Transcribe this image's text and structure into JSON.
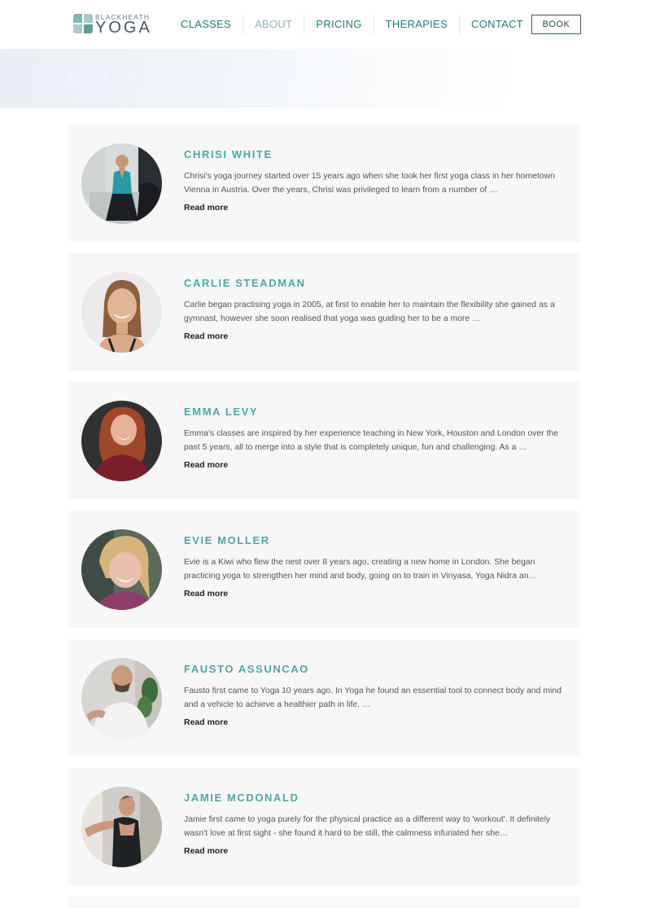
{
  "brand": {
    "top": "BLACKHEATH",
    "bottom": "YOGA"
  },
  "nav": {
    "items": [
      {
        "label": "CLASSES",
        "active": false
      },
      {
        "label": "ABOUT",
        "active": true
      },
      {
        "label": "PRICING",
        "active": false
      },
      {
        "label": "THERAPIES",
        "active": false
      },
      {
        "label": "CONTACT",
        "active": false
      }
    ],
    "book_label": "BOOK"
  },
  "hero": {
    "title": "OUR TEACHERS"
  },
  "teachers": [
    {
      "name": "CHRISI WHITE",
      "bio": "Chrisi's yoga journey started over 15 years ago when she took her first yoga class in her hometown Vienna in Austria. Over the years, Chrisi was privileged to learn from a number of …",
      "read_more": "Read more"
    },
    {
      "name": "CARLIE STEADMAN",
      "bio": "Carlie began practising yoga in 2005, at first to enable her to maintain the flexibility she gained as a gymnast, however she soon realised that yoga was guiding her to be a more …",
      "read_more": "Read more"
    },
    {
      "name": "EMMA LEVY",
      "bio": "Emma's classes are inspired by her experience teaching in New York, Houston and London over the past 5 years, all to merge into a style that is completely unique, fun and challenging. As a …",
      "read_more": "Read more"
    },
    {
      "name": "EVIE MOLLER",
      "bio": "Evie is a Kiwi who flew the nest over 8 years ago, creating a new home in London. She began practicing yoga to strengthen her mind and body, going on to train in Vinyasa, Yoga Nidra an…",
      "read_more": "Read more"
    },
    {
      "name": "FAUSTO ASSUNCAO",
      "bio": "Fausto first came to Yoga 10 years ago. In Yoga he found an essential tool to connect body and mind and a vehicle to achieve a healthier path in life. …",
      "read_more": "Read more"
    },
    {
      "name": "JAMIE MCDONALD",
      "bio": "Jamie first came to yoga purely for the physical practice as a different way to 'workout'. It definitely wasn't love at first sight - she found it hard to be still, the calmness infuriated her she…",
      "read_more": "Read more"
    }
  ],
  "colors": {
    "accent": "#1f7d7a",
    "name": "#4fa6a4",
    "card_bg": "#f7f7f7",
    "nav_active": "#8fb3b8"
  }
}
